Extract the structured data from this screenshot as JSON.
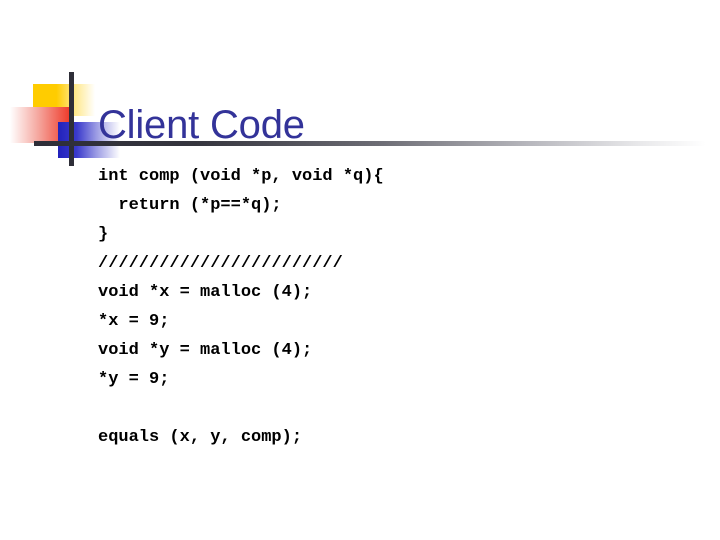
{
  "slide": {
    "title": "Client Code",
    "title_color": "#333399",
    "background_color": "#ffffff"
  },
  "logo": {
    "yellow_square_color": "#FFCC00",
    "red_square_color": "#EE3322",
    "blue_square_color": "#2222BB",
    "bar_color": "#2E2E38"
  },
  "code": {
    "lines": [
      "int comp (void *p, void *q){",
      "  return (*p==*q);",
      "}",
      "////////////////////////",
      "void *x = malloc (4);",
      "*x = 9;",
      "void *y = malloc (4);",
      "*y = 9;",
      "",
      "equals (x, y, comp);"
    ]
  }
}
